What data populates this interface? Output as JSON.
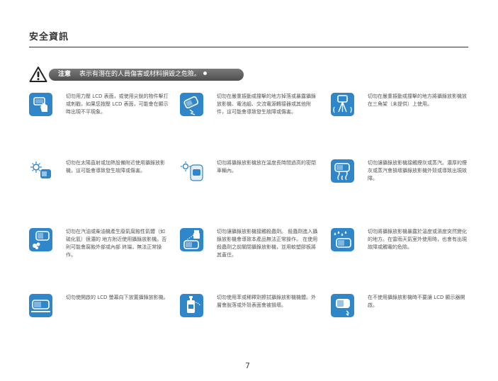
{
  "section_title": "安全資訊",
  "warning": {
    "label": "注意",
    "text": "表示有潛在的人員傷害或材料損毀之危險。"
  },
  "items": [
    {
      "icon": "finger-press-icon",
      "text": "切勿用力壓 LCD 表面，或使用尖銳的物件擊打或刺戳，如果您按壓 LCD 表面，可能會在顯示時出現不平現象。"
    },
    {
      "icon": "device-impact-icon",
      "text": "切勿在嚴重振動或撞擊的地方掉落或暴露攝錄放影機、電池組、交流電源轉接器或其他附件，這可能會導致發生故障或傷害。"
    },
    {
      "icon": "tripod-vibration-icon",
      "text": "切勿在嚴重振動或撞擊的地方將攝錄放影機放在三角架（未提供）上使用。"
    },
    {
      "icon": "sunlight-icon",
      "text": "切勿在太陽直射或加熱設備附近使用攝錄放影機，這可能會導致發生故障或傷害。"
    },
    {
      "icon": "hot-car-icon",
      "text": "切勿將攝錄放影機放在溫度長時間過高的密閉車輛內。"
    },
    {
      "icon": "smoke-steam-icon",
      "text": "切勿讓攝錄放影機接觸煙灰或蒸汽。濃厚的煙灰或蒸汽會損壞攝錄放影機外殼或導致出現故障。"
    },
    {
      "icon": "corrosive-gas-icon",
      "text": "切勿在汽油或柴油機產生廢氣腐蝕性氣體（如硫化氫）很濃的 地方附近使用攝錄放影機。否則可能會腐蝕外部或內部 終端，無法正常操作。"
    },
    {
      "icon": "spray-icon",
      "text": "切勿讓攝錄放影機接觸殺蟲劑。 殺蟲劑進入攝錄放影機會導致本產品無法正常操作。 在使用殺蟲劑之前關閉攝錄放影機，並用軟塑膠板將其蓋住。"
    },
    {
      "icon": "humidity-icon",
      "text": "切勿將攝錄放影機暴露於溫度或濕度突然變化的地方。在雷雨天氣室外使用時，也會有出現故障或觸電的危險。"
    },
    {
      "icon": "lcd-facedown-icon",
      "text": "切勿使開啟的 LCD 螢幕向下放置攝錄放影機。"
    },
    {
      "icon": "chemical-bottle-icon",
      "text": "切勿使用苯或稀釋劑擦拭攝錄放影機機體。外層會脫落或外殼表面會被損壞。"
    },
    {
      "icon": "lcd-close-icon",
      "text": "在不使用攝錄放影機時不要讓 LCD 顯示器開啟。"
    }
  ],
  "page_number": "7",
  "colors": {
    "icon_bg": "#2f86c9",
    "pill_bg": "#5e5e5e",
    "rule": "#333333"
  }
}
